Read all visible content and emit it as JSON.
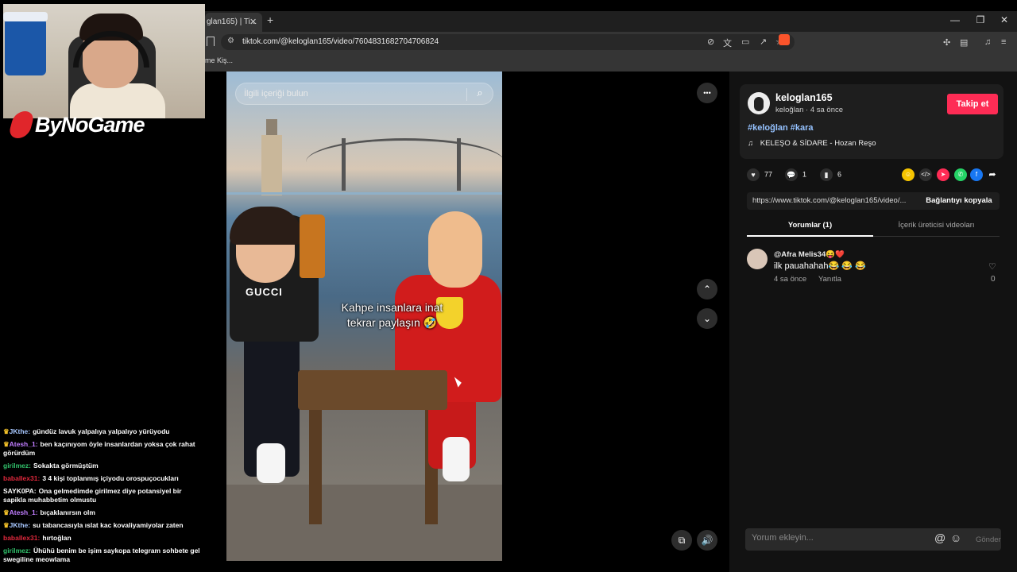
{
  "browser": {
    "tab_title": "glan165) | Ti...",
    "tab_close": "✕",
    "new_tab": "+",
    "window_controls": [
      "—",
      "❐",
      "✕"
    ],
    "url": "tiktok.com/@keloglan165/video/7604831682704706824",
    "bookmark_label": "me Kiş..."
  },
  "overlay": {
    "logo_text": "ByNoGame"
  },
  "chat": {
    "messages": [
      {
        "user": "JKthe:",
        "text": "gündüz lavuk yalpalıya yalpalıyo yürüyodu",
        "color": "#a7c7ff",
        "crown": true
      },
      {
        "user": "Atesh_1:",
        "text": "ben kaçınıyom öyle insanlardan yoksa çok rahat görürdüm",
        "color": "#c07dff",
        "crown": true
      },
      {
        "user": "girilmez:",
        "text": "Sokakta görmüştüm",
        "color": "#32c36c",
        "crown": false
      },
      {
        "user": "baballex31:",
        "text": "3 4 kişi toplanmış içiyodu orospuçocukları",
        "color": "#e0283c",
        "crown": false
      },
      {
        "user": "SAYK0PA:",
        "text": "Ona gelmedimde girilmez diye potansiyel bir sapikla muhabbetim olmustu",
        "color": "#ffffff",
        "crown": false
      },
      {
        "user": "Atesh_1:",
        "text": "bıçaklanırsın olm",
        "color": "#c07dff",
        "crown": true
      },
      {
        "user": "JKthe:",
        "text": "su tabancasıyla ıslat kac kovaliyamiyolar zaten",
        "color": "#a7c7ff",
        "crown": true
      },
      {
        "user": "baballex31:",
        "text": "hırtoğlan",
        "color": "#e0283c",
        "crown": false
      },
      {
        "user": "girilmez:",
        "text": "Ühühü benim be işim saykopa telegram sohbete gel swegiline meowlama",
        "color": "#32c36c",
        "crown": false
      }
    ]
  },
  "video": {
    "search_placeholder": "İlgili içeriği bulun",
    "caption_line1": "Kahpe insanlara inat",
    "caption_line2": "tekrar paylaşın 🤣",
    "more_icon": "•••",
    "up_icon": "⌃",
    "down_icon": "⌄"
  },
  "profile": {
    "username": "keloglan165",
    "subline": "keloğlan · 4 sa önce",
    "follow_label": "Takip et",
    "hashtags": "#keloğlan #kara",
    "music_icon": "♫",
    "music": "KELEŞO & SİDARE - Hozan Reşo"
  },
  "stats": {
    "likes": "77",
    "comments": "1",
    "saves": "6"
  },
  "link": {
    "url": "https://www.tiktok.com/@keloglan165/video/...",
    "copy_label": "Bağlantıyı kopyala"
  },
  "tabs": {
    "comments": "Yorumlar (1)",
    "creator_videos": "İçerik üreticisi videoları"
  },
  "comment": {
    "user": "@Afra Melis34😝❤️",
    "text": "ilk pauahahah😂 😂 😂",
    "time": "4 sa önce",
    "reply": "Yanıtla",
    "like_count": "0"
  },
  "comment_bar": {
    "placeholder": "Yorum ekleyin...",
    "at_icon": "@",
    "emoji_icon": "☺",
    "send_label": "Gönder"
  },
  "colors": {
    "brand_red": "#fe2c55",
    "hashtag": "#95c2ff"
  }
}
